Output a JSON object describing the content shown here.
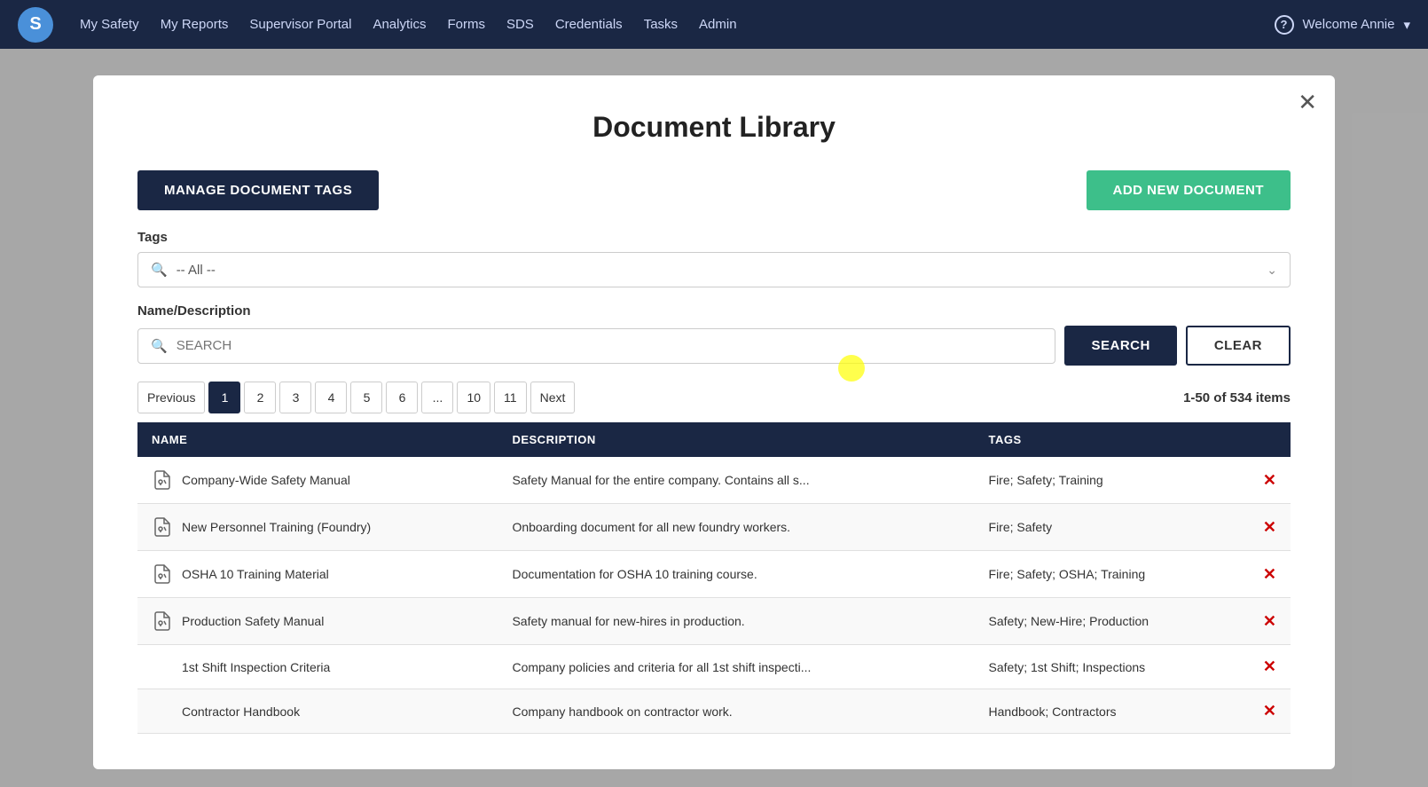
{
  "navbar": {
    "logo": "S",
    "links": [
      {
        "label": "My Safety",
        "name": "my-safety"
      },
      {
        "label": "My Reports",
        "name": "my-reports"
      },
      {
        "label": "Supervisor Portal",
        "name": "supervisor-portal"
      },
      {
        "label": "Analytics",
        "name": "analytics"
      },
      {
        "label": "Forms",
        "name": "forms"
      },
      {
        "label": "SDS",
        "name": "sds"
      },
      {
        "label": "Credentials",
        "name": "credentials"
      },
      {
        "label": "Tasks",
        "name": "tasks"
      },
      {
        "label": "Admin",
        "name": "admin"
      }
    ],
    "user": "Welcome Annie"
  },
  "modal": {
    "title": "Document Library",
    "manage_tags_label": "MANAGE DOCUMENT TAGS",
    "add_new_label": "ADD NEW DOCUMENT",
    "tags_label": "Tags",
    "tags_placeholder": "-- All --",
    "name_desc_label": "Name/Description",
    "search_placeholder": "SEARCH",
    "search_button": "SEARCH",
    "clear_button": "CLEAR",
    "items_count": "1-50 of 534 items",
    "pagination": {
      "previous": "Previous",
      "next": "Next",
      "pages": [
        "1",
        "2",
        "3",
        "4",
        "5",
        "6",
        "...",
        "10",
        "11"
      ]
    },
    "table": {
      "headers": [
        "NAME",
        "DESCRIPTION",
        "TAGS"
      ],
      "rows": [
        {
          "name": "Company-Wide Safety Manual",
          "description": "Safety Manual for the entire company. Contains all s...",
          "tags": "Fire; Safety; Training",
          "has_icon": true
        },
        {
          "name": "New Personnel Training (Foundry)",
          "description": "Onboarding document for all new foundry workers.",
          "tags": "Fire; Safety",
          "has_icon": true
        },
        {
          "name": "OSHA 10 Training Material",
          "description": "Documentation for OSHA 10 training course.",
          "tags": "Fire; Safety; OSHA; Training",
          "has_icon": true
        },
        {
          "name": "Production Safety Manual",
          "description": "Safety manual for new-hires in production.",
          "tags": "Safety; New-Hire; Production",
          "has_icon": true
        },
        {
          "name": "1st Shift Inspection Criteria",
          "description": "Company policies and criteria for all 1st shift inspecti...",
          "tags": "Safety; 1st Shift; Inspections",
          "has_icon": false
        },
        {
          "name": "Contractor Handbook",
          "description": "Company handbook on contractor work.",
          "tags": "Handbook; Contractors",
          "has_icon": false
        }
      ]
    }
  }
}
